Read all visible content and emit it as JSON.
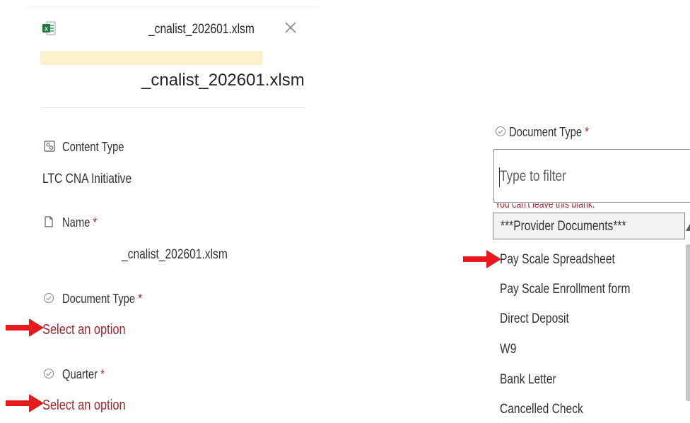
{
  "header": {
    "file_icon": "excel-file-icon",
    "title": "_cnalist_202601.xlsm",
    "close_icon": "close-icon"
  },
  "file_title": "_cnalist_202601.xlsm",
  "form": {
    "content_type": {
      "icon": "content-type-icon",
      "label": "Content Type",
      "value": "LTC CNA Initiative"
    },
    "name": {
      "icon": "document-icon",
      "label": "Name",
      "required_mark": "*",
      "value": "_cnalist_202601.xlsm"
    },
    "document_type": {
      "icon": "circle-check-icon",
      "label": "Document Type",
      "required_mark": "*",
      "value": "Select an option"
    },
    "quarter": {
      "icon": "circle-check-icon",
      "label": "Quarter",
      "required_mark": "*",
      "value": "Select an option"
    }
  },
  "dropdown": {
    "label_icon": "circle-check-icon",
    "label": "Document Type",
    "required_mark": "*",
    "filter_placeholder": "Type to filter",
    "error_message": "You can't leave this blank.",
    "options": [
      "***Provider Documents***",
      "Pay Scale Spreadsheet",
      "Pay Scale Enrollment form",
      "Direct Deposit",
      "W9",
      "Bank Letter",
      "Cancelled Check"
    ],
    "selected_index": 0
  },
  "annotations": {
    "arrow_icon": "red-arrow-icon",
    "arrow_color": "#e8191c"
  },
  "colors": {
    "error_red": "#a4262c",
    "highlight": "#fdf0cc",
    "excel_green": "#1f7a40"
  }
}
